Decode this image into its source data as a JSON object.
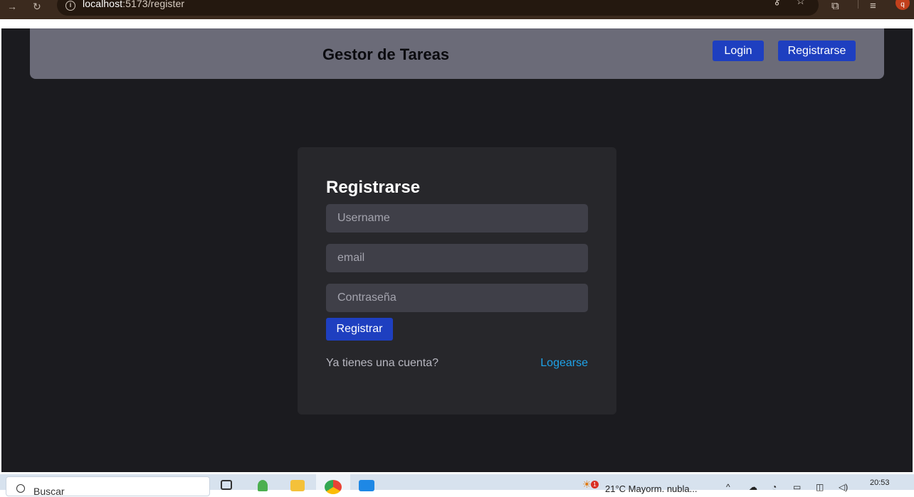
{
  "browser": {
    "url_host": "localhost",
    "url_path": ":5173/register"
  },
  "header": {
    "title": "Gestor de Tareas",
    "login_label": "Login",
    "register_label": "Registrarse"
  },
  "form": {
    "title": "Registrarse",
    "username_placeholder": "Username",
    "email_placeholder": "email",
    "password_placeholder": "Contraseña",
    "submit_label": "Registrar",
    "question_text": "Ya tienes una cuenta?",
    "login_link": "Logearse"
  },
  "taskbar": {
    "search_text": "Buscar",
    "weather_text": "21°C  Mayorm. nubla...",
    "weather_badge": "1",
    "clock": "20:53"
  },
  "colors": {
    "page_bg": "#1b1b1f",
    "header_bg": "#6b6b78",
    "card_bg": "#27272b",
    "input_bg": "#3f3f48",
    "primary_button": "#1e3fc0",
    "link": "#1ea2e8"
  }
}
